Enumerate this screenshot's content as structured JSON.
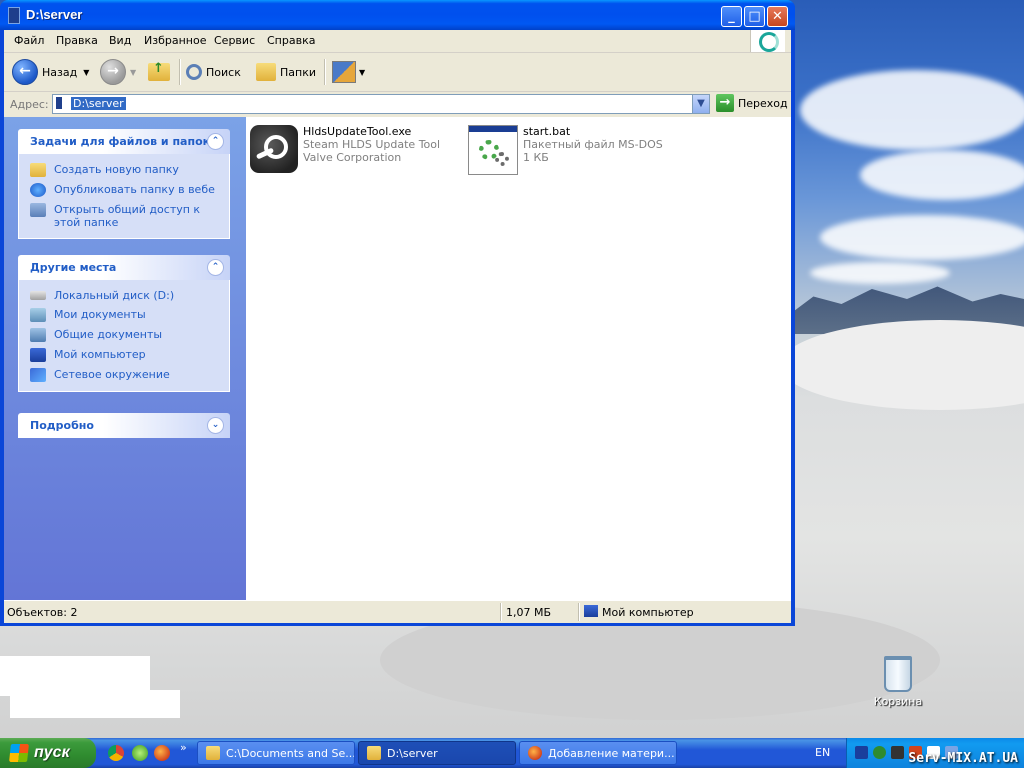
{
  "window": {
    "title": "D:\\server",
    "minimize_glyph": "_",
    "maximize_glyph": "□",
    "close_glyph": "✕"
  },
  "menu": [
    "Файл",
    "Правка",
    "Вид",
    "Избранное",
    "Сервис",
    "Справка"
  ],
  "toolbar": {
    "back_label": "Назад",
    "search_label": "Поиск",
    "folders_label": "Папки"
  },
  "address": {
    "label": "Адрес:",
    "value": "D:\\server",
    "go_label": "Переход"
  },
  "tasks_panel": {
    "title": "Задачи для файлов и папок",
    "items": [
      "Создать новую папку",
      "Опубликовать папку в вебе",
      "Открыть общий доступ к этой папке"
    ]
  },
  "places_panel": {
    "title": "Другие места",
    "items": [
      "Локальный диск (D:)",
      "Мои документы",
      "Общие документы",
      "Мой компьютер",
      "Сетевое окружение"
    ]
  },
  "details_panel": {
    "title": "Подробно"
  },
  "files": [
    {
      "name": "HldsUpdateTool.exe",
      "desc": "Steam HLDS Update Tool",
      "extra": "Valve Corporation",
      "icon": "steam-icon"
    },
    {
      "name": "start.bat",
      "desc": "Пакетный файл MS-DOS",
      "extra": "1 КБ",
      "icon": "batch-file-icon"
    }
  ],
  "status": {
    "objects": "Объектов: 2",
    "size": "1,07 МБ",
    "location": "Мой компьютер"
  },
  "desktop": {
    "recycle_label": "Корзина",
    "watermark": "Serv-MIX.AT.UA"
  },
  "taskbar": {
    "start_label": "пуск",
    "chevron": "»",
    "tasks": [
      "C:\\Documents and Se...",
      "D:\\server",
      "Добавление матери..."
    ],
    "lang": "EN"
  }
}
